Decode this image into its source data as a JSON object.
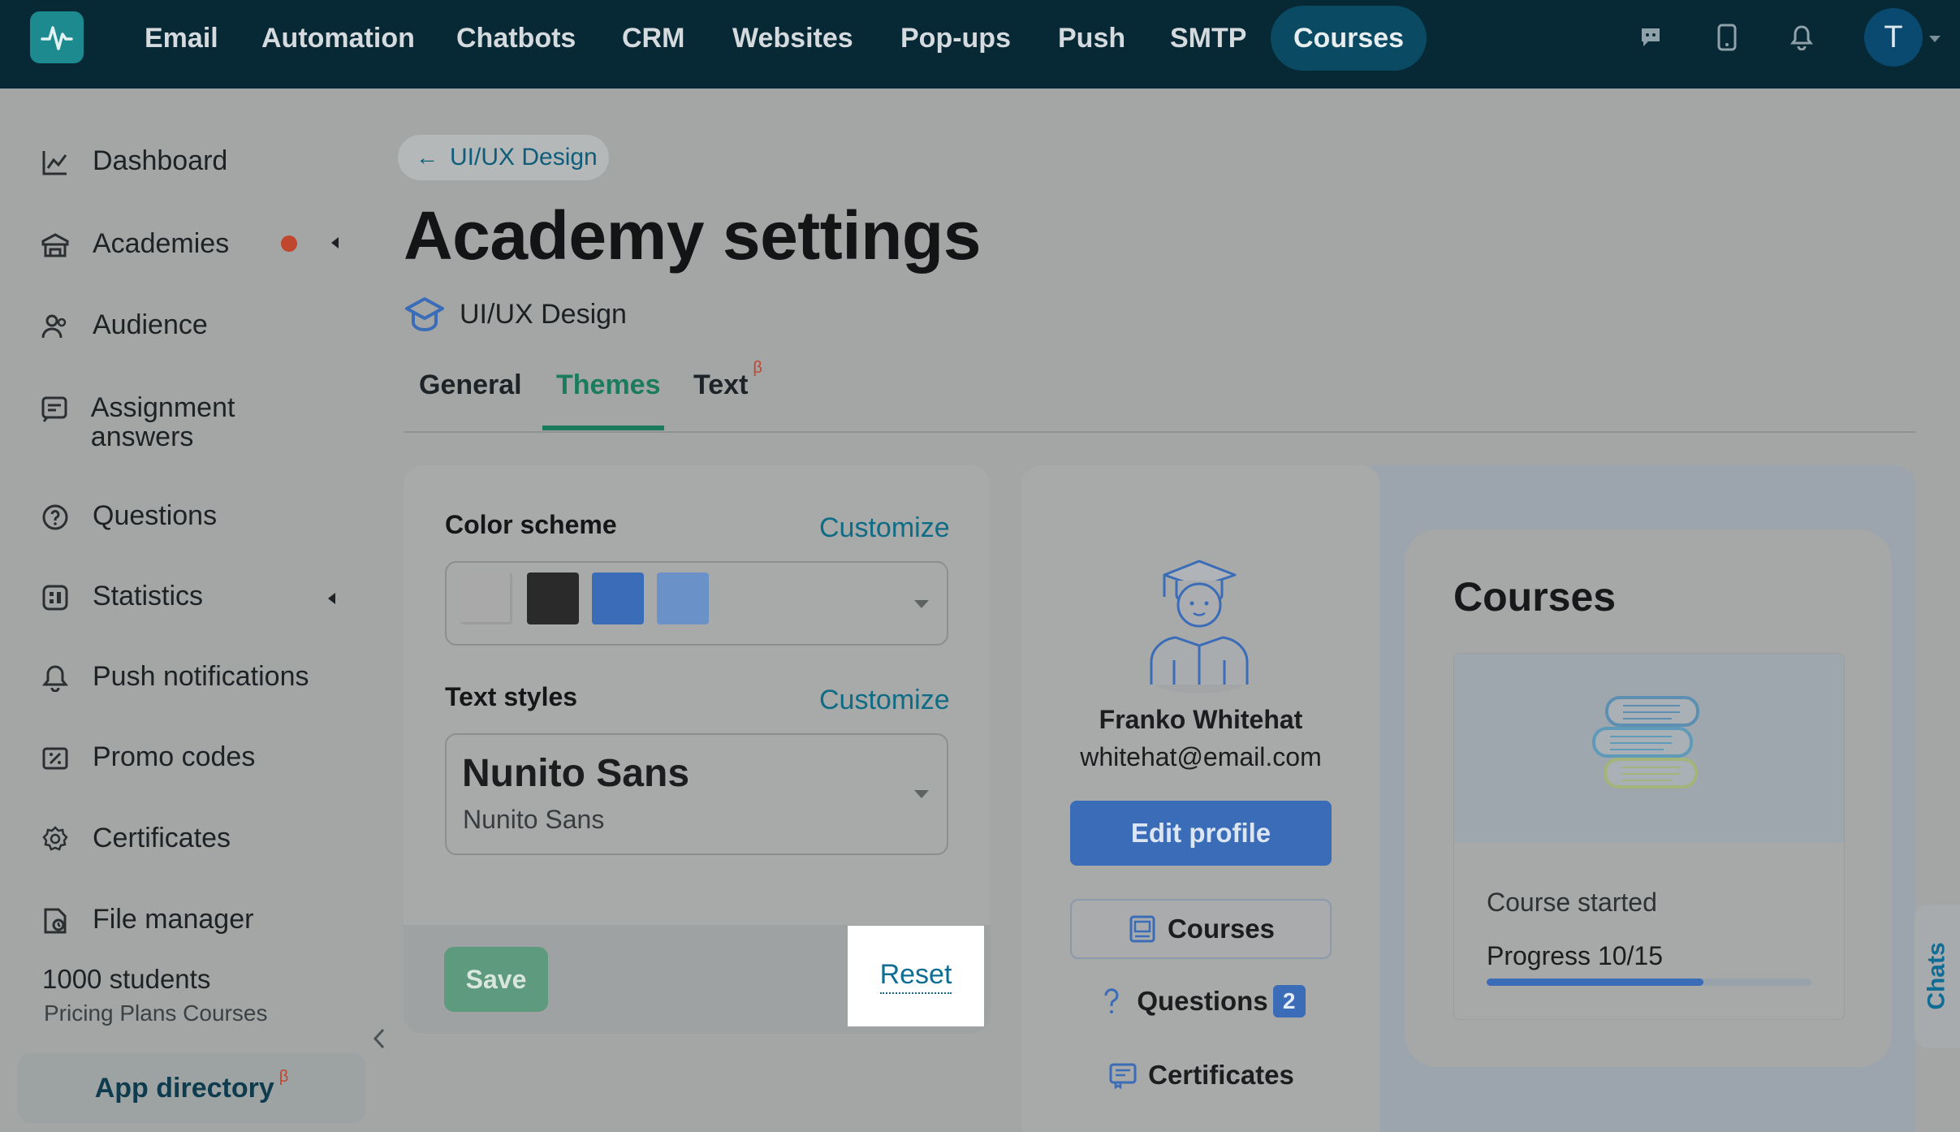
{
  "topnav": {
    "items": [
      "Email",
      "Automation",
      "Chatbots",
      "CRM",
      "Websites",
      "Pop-ups",
      "Push",
      "SMTP",
      "Courses"
    ],
    "active": "Courses",
    "avatar_letter": "T",
    "icons": [
      "logo-icon",
      "chat-icon",
      "mobile-icon",
      "bell-icon"
    ]
  },
  "sidebar": {
    "items": [
      {
        "label": "Dashboard",
        "icon": "chart-line-icon"
      },
      {
        "label": "Academies",
        "icon": "academy-icon"
      },
      {
        "label": "Audience",
        "icon": "users-icon"
      },
      {
        "label": "Assignment answers",
        "icon": "assignment-icon"
      },
      {
        "label": "Questions",
        "icon": "question-icon"
      },
      {
        "label": "Statistics",
        "icon": "statistics-icon"
      },
      {
        "label": "Push notifications",
        "icon": "bell-icon"
      },
      {
        "label": "Promo codes",
        "icon": "promo-icon"
      },
      {
        "label": "Certificates",
        "icon": "certificate-icon"
      },
      {
        "label": "File manager",
        "icon": "file-icon"
      }
    ],
    "students": "1000 students",
    "plan": "Pricing Plans Courses",
    "app_directory": "App directory",
    "beta": "β"
  },
  "header": {
    "back_label": "UI/UX Design",
    "title": "Academy settings",
    "academy_name": "UI/UX Design"
  },
  "tabs": [
    {
      "label": "General"
    },
    {
      "label": "Themes"
    },
    {
      "label": "Text",
      "beta": "β"
    }
  ],
  "settings": {
    "color_scheme_label": "Color scheme",
    "customize": "Customize",
    "swatches": [
      "#a9a9a9",
      "#2a2a2a",
      "#3a6cb8",
      "#6a92c8"
    ],
    "text_styles_label": "Text styles",
    "font_title": "Nunito Sans",
    "font_sub": "Nunito Sans",
    "save": "Save",
    "reset": "Reset"
  },
  "preview": {
    "name": "Franko Whitehat",
    "email": "whitehat@email.com",
    "edit_profile": "Edit profile",
    "menu": {
      "courses": "Courses",
      "questions": "Questions",
      "questions_count": "2",
      "certificates": "Certificates"
    },
    "courses_title": "Courses",
    "course_status": "Course started",
    "course_progress": "Progress 10/15",
    "progress_fraction": 0.667
  },
  "chats": "Chats"
}
